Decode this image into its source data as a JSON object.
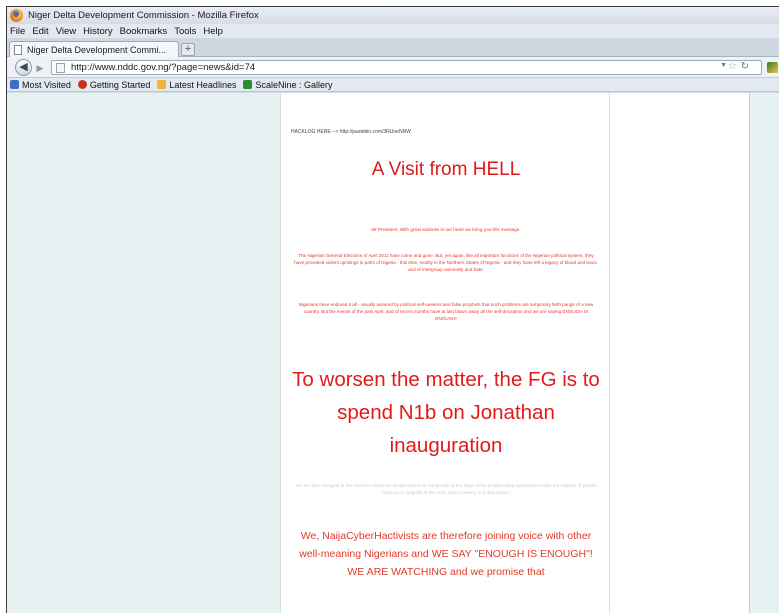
{
  "window": {
    "title": "Niger Delta Development Commission - Mozilla Firefox"
  },
  "menu": [
    "File",
    "Edit",
    "View",
    "History",
    "Bookmarks",
    "Tools",
    "Help"
  ],
  "tabs": {
    "active_label": "Niger Delta Development Commi...",
    "new_tab_label": "+"
  },
  "nav": {
    "url": "http://www.nddc.gov.ng/?page=news&id=74"
  },
  "bookmarks": [
    {
      "label": "Most Visited",
      "icon": "bookmark-folder-icon"
    },
    {
      "label": "Getting Started",
      "icon": "firefox-icon"
    },
    {
      "label": "Latest Headlines",
      "icon": "rss-icon"
    },
    {
      "label": "ScaleNine : Gallery",
      "icon": "site-icon"
    }
  ],
  "page": {
    "hacklog": "HACKLOG HERE --> http://pastebin.com/3RUneNRW",
    "headline": "A Visit from HELL",
    "p1": "Mr President, With great sadness in our heart we bring you this message.",
    "p2": "The Nigerian General Elections of April 2011 have come and gone. But, yet again, like all important functions of the Nigerian political system, they have provoked violent uprisings in parts of Nigeria - this time, mostly in the Northern States of Nigeria - and they have left a legacy of blood and tears, and of intergroup animosity and hate.",
    "p3": "Nigerians have endured it all - usually assured by political self-seekers and false prophets that such problems are temporary birth pangs of a new country. But the events of the past April, and of recent months have at last blown away all the self-deception and we are saying ENOUGH IS ENOUGH!",
    "big": "To worsen the matter, the FG is to spend N1b on Jonathan inauguration",
    "faint": "We are also outraged at the extent to which the wealth meant for the people of the Niger Delta is daily being squandered while the masses of people continue to languish in the most abject poverty and deprivation.",
    "closing": "We, NaijaCyberHactivists are therefore joining voice with other well-meaning Nigerians and WE SAY \"ENOUGH IS ENOUGH\"! WE ARE WATCHING and we promise that"
  },
  "colors": {
    "accent_red": "#e01818",
    "page_background": "#e6f1f1"
  }
}
